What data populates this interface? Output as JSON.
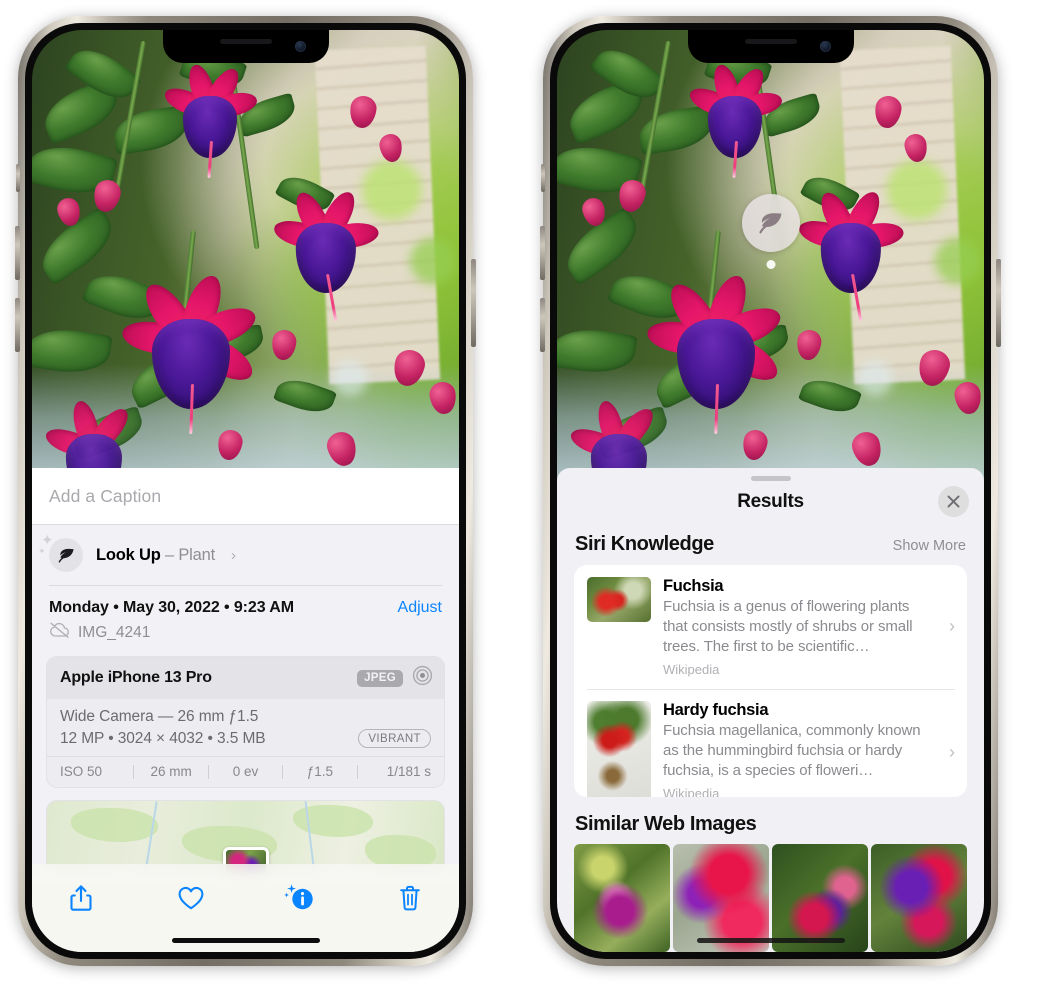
{
  "left_phone": {
    "caption": {
      "placeholder": "Add a Caption",
      "value": ""
    },
    "lookup": {
      "label": "Look Up",
      "separator": " – ",
      "subject": "Plant",
      "chevron": "›",
      "icon": "leaf-icon"
    },
    "metadata": {
      "date": "Monday • May 30, 2022 • 9:23 AM",
      "adjust_label": "Adjust",
      "filename": "IMG_4241",
      "cloud_icon": "cloud-slash-icon"
    },
    "camera_card": {
      "model": "Apple iPhone 13 Pro",
      "format_badge": "JPEG",
      "lens_icon": "aperture-icon",
      "lens_line": "Wide Camera — 26 mm ƒ1.5",
      "size_line": "12 MP • 3024 × 4032 • 3.5 MB",
      "style_badge": "VIBRANT",
      "exif": [
        "ISO 50",
        "26 mm",
        "0 ev",
        "ƒ1.5",
        "1/181 s"
      ]
    },
    "toolbar": [
      {
        "name": "share-button",
        "icon": "share-icon"
      },
      {
        "name": "favorite-button",
        "icon": "heart-icon"
      },
      {
        "name": "info-button",
        "icon": "info-sparkle-icon"
      },
      {
        "name": "delete-button",
        "icon": "trash-icon"
      }
    ],
    "accent_color": "#0a84ff"
  },
  "right_phone": {
    "marker": {
      "icon": "leaf-icon"
    },
    "sheet": {
      "title": "Results",
      "close_icon": "close-icon",
      "siri_section": {
        "title": "Siri Knowledge",
        "action": "Show More",
        "cards": [
          {
            "title": "Fuchsia",
            "description": "Fuchsia is a genus of flowering plants that consists mostly of shrubs or small trees. The first to be scientific…",
            "source": "Wikipedia",
            "chevron": "›"
          },
          {
            "title": "Hardy fuchsia",
            "description": "Fuchsia magellanica, commonly known as the hummingbird fuchsia or hardy fuchsia, is a species of floweri…",
            "source": "Wikipedia",
            "chevron": "›"
          }
        ]
      },
      "web_section": {
        "title": "Similar Web Images",
        "thumbnails": [
          "web-image-1",
          "web-image-2",
          "web-image-3",
          "web-image-4"
        ]
      }
    }
  }
}
